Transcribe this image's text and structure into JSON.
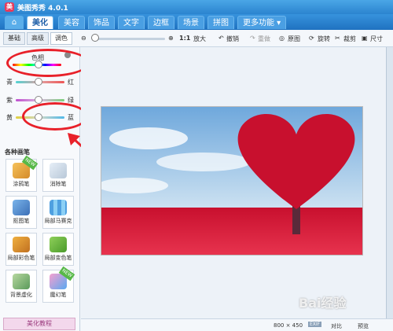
{
  "app": {
    "title": "美图秀秀 4.0.1"
  },
  "menu": {
    "tabs": [
      "美化",
      "美容",
      "饰品",
      "文字",
      "边框",
      "场景",
      "拼图"
    ],
    "more": "更多功能"
  },
  "toolbar": {
    "subtabs": [
      "基础",
      "高级",
      "调色"
    ],
    "ratio": "1:1",
    "enlarge": "放大",
    "undo": "撤销",
    "redo": "重做",
    "original": "原图",
    "rotate": "旋转",
    "crop": "裁剪",
    "resize": "尺寸"
  },
  "color_adjust": {
    "hue_label": "色相",
    "cyan": "青",
    "red": "红",
    "purple": "紫",
    "green": "绿",
    "yellow": "黄",
    "blue": "蓝"
  },
  "brushes": {
    "title": "各种画笔",
    "tools": [
      "涂鸦笔",
      "消除笔",
      "抠图笔",
      "局部马赛克",
      "局部彩色笔",
      "局部变色笔",
      "背景虚化",
      "魔幻笔"
    ]
  },
  "tutorial": "美化教程",
  "status": {
    "size": "800 × 450",
    "exif": "EXIF",
    "compare": "对比",
    "preview": "预览"
  },
  "watermark": "Bai经验",
  "colors": {
    "accent": "#2b84cf",
    "annotation": "#e8212a"
  }
}
